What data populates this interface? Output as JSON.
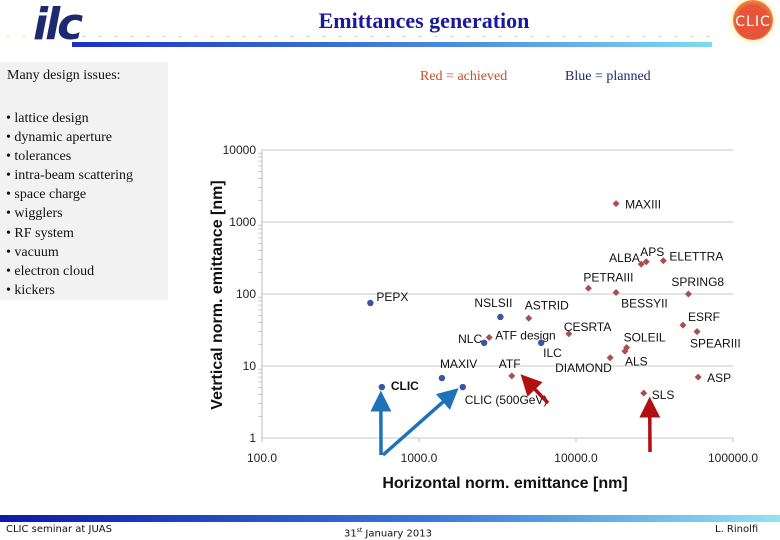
{
  "header": {
    "title": "Emittances generation",
    "left_logo": "ilc",
    "right_logo": "CLIC"
  },
  "left_panel": {
    "heading": "Many design issues:",
    "items": [
      "• lattice design",
      "• dynamic aperture",
      "• tolerances",
      "• intra-beam scattering",
      "• space charge",
      "• wigglers",
      "• RF system",
      "• vacuum",
      "• electron cloud",
      "• kickers"
    ]
  },
  "legend": {
    "red": "Red = achieved",
    "blue": "Blue = planned"
  },
  "colors": {
    "achieved": "#a85050",
    "planned": "#3b55a0",
    "arrow_blue": "#1d72b8",
    "arrow_red": "#b01010",
    "title": "#1a1a9a"
  },
  "chart_data": {
    "type": "scatter",
    "title": "",
    "xlabel": "Horizontal norm. emittance [nm]",
    "ylabel": "Vetrtical norm. emittance [nm]",
    "xscale": "log",
    "yscale": "log",
    "xlim": [
      100,
      100000
    ],
    "ylim": [
      1,
      10000
    ],
    "xticks": [
      "100.0",
      "1000.0",
      "10000.0",
      "100000.0"
    ],
    "yticks": [
      "1",
      "10",
      "100",
      "1000",
      "10000"
    ],
    "grid": "horizontal",
    "series": [
      {
        "name": "planned",
        "color": "blue",
        "points": [
          {
            "label": "PEPX",
            "x": 490,
            "y": 75
          },
          {
            "label": "CLIC",
            "x": 580,
            "y": 5.1,
            "bold": true
          },
          {
            "label": "MAXIV",
            "x": 1400,
            "y": 6.8
          },
          {
            "label": "CLIC (500GeV)",
            "x": 1900,
            "y": 5.1
          },
          {
            "label": "NSLSII",
            "x": 3300,
            "y": 48
          },
          {
            "label": "NLC",
            "x": 2600,
            "y": 21
          },
          {
            "label": "ILC",
            "x": 6000,
            "y": 21
          }
        ]
      },
      {
        "name": "achieved",
        "color": "red",
        "points": [
          {
            "label": "ATF",
            "x": 3900,
            "y": 7.3
          },
          {
            "label": "ATF design",
            "x": 2800,
            "y": 25
          },
          {
            "label": "ASTRID",
            "x": 5000,
            "y": 46
          },
          {
            "label": "CESRTA",
            "x": 9000,
            "y": 28
          },
          {
            "label": "MAXIII",
            "x": 18000,
            "y": 1800
          },
          {
            "label": "ALBA",
            "x": 26000,
            "y": 260
          },
          {
            "label": "APS",
            "x": 28000,
            "y": 280
          },
          {
            "label": "ELETTRA",
            "x": 36000,
            "y": 290
          },
          {
            "label": "PETRAIII",
            "x": 12000,
            "y": 120
          },
          {
            "label": "BESSYII",
            "x": 18000,
            "y": 105
          },
          {
            "label": "SPRING8",
            "x": 52000,
            "y": 100
          },
          {
            "label": "ESRF",
            "x": 48000,
            "y": 37
          },
          {
            "label": "SPEARIII",
            "x": 59000,
            "y": 30
          },
          {
            "label": "SOLEIL",
            "x": 21000,
            "y": 18
          },
          {
            "label": "ALS",
            "x": 20500,
            "y": 16
          },
          {
            "label": "DIAMOND",
            "x": 16500,
            "y": 13
          },
          {
            "label": "SLS",
            "x": 27000,
            "y": 4.2
          },
          {
            "label": "ASP",
            "x": 60000,
            "y": 7
          }
        ]
      }
    ],
    "annotations": [
      {
        "type": "arrow",
        "color": "blue",
        "target": "CLIC"
      },
      {
        "type": "arrow",
        "color": "blue",
        "target": "CLIC (500GeV)"
      },
      {
        "type": "arrow",
        "color": "red",
        "target": "ATF"
      },
      {
        "type": "arrow",
        "color": "red",
        "target": "SLS"
      }
    ]
  },
  "footer": {
    "left": "CLIC seminar at JUAS",
    "center_day": "31",
    "center_sup": "st",
    "center_rest": " January 2013",
    "right": "L. Rinolfi"
  }
}
